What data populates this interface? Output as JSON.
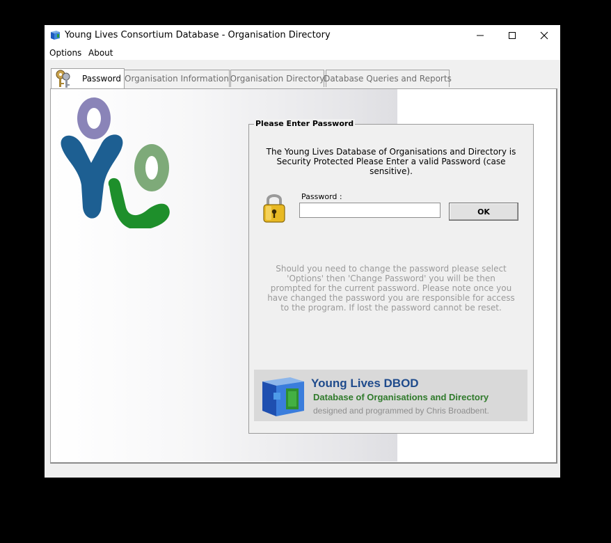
{
  "window": {
    "title": "Young Lives Consortium Database - Organisation Directory",
    "controls": [
      "minimize-icon",
      "maximize-icon",
      "close-icon"
    ]
  },
  "menu": [
    "Options",
    "About"
  ],
  "tabs": [
    {
      "label": "Password",
      "active": true,
      "icon": "keys-icon"
    },
    {
      "label": "Organisation Information",
      "active": false
    },
    {
      "label": "Organisation Directory",
      "active": false
    },
    {
      "label": "Database Queries and Reports",
      "active": false
    }
  ],
  "logo": {
    "letters": "YL",
    "colors": [
      "#8a84b8",
      "#1d5f92",
      "#7eaa79",
      "#1e8f2b"
    ]
  },
  "password_panel": {
    "group_title": "Please Enter Password",
    "intro_line1": "The Young Lives Database of Organisations and Directory is",
    "intro_line2": "Security Protected Please Enter a valid Password (case sensitive).",
    "lock_icon": "lock-icon",
    "password_label": "Password :",
    "password_value": "",
    "ok_label": "OK",
    "note_lines": [
      "Should you need to change the password please select",
      "'Options' then 'Change Password' you will be then",
      "prompted for the current password. Please note once you",
      "have changed the password you are responsible for access",
      "to the program. If lost the password cannot be reset."
    ]
  },
  "banner": {
    "title": "Young Lives DBOD",
    "subtitle": "Database of Organisations and Directory",
    "credit": "designed and programmed by Chris Broadbent."
  }
}
